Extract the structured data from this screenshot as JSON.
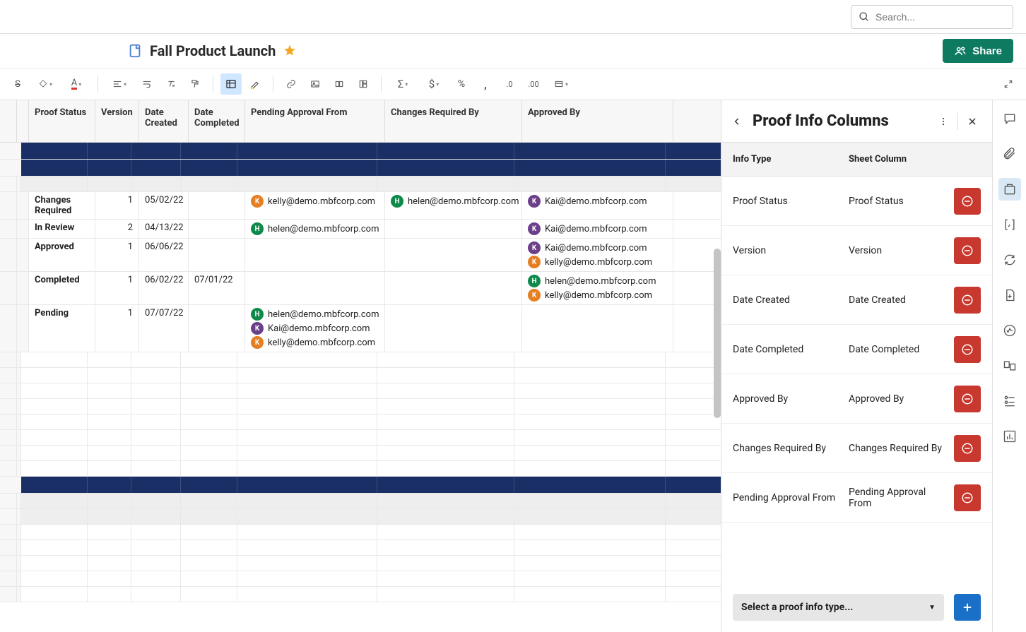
{
  "search": {
    "placeholder": "Search..."
  },
  "header": {
    "title": "Fall Product Launch",
    "share": "Share"
  },
  "grid": {
    "columns": {
      "proof_status": "Proof Status",
      "version": "Version",
      "date_created": "Date Created",
      "date_completed": "Date Completed",
      "pending_approval_from": "Pending Approval From",
      "changes_required_by": "Changes Required By",
      "approved_by": "Approved By"
    },
    "rows": [
      {
        "status": "Changes Required",
        "version": "1",
        "created": "05/02/22",
        "completed": "",
        "pending": [
          {
            "initial": "K",
            "cls": "av-k",
            "email": "kelly@demo.mbfcorp.com"
          }
        ],
        "changes": [
          {
            "initial": "H",
            "cls": "av-h",
            "email": "helen@demo.mbfcorp.com"
          }
        ],
        "approved": [
          {
            "initial": "K",
            "cls": "av-kai",
            "email": "Kai@demo.mbfcorp.com"
          }
        ]
      },
      {
        "status": "In Review",
        "version": "2",
        "created": "04/13/22",
        "completed": "",
        "pending": [
          {
            "initial": "H",
            "cls": "av-h",
            "email": "helen@demo.mbfcorp.com"
          }
        ],
        "changes": [],
        "approved": [
          {
            "initial": "K",
            "cls": "av-kai",
            "email": "Kai@demo.mbfcorp.com"
          }
        ]
      },
      {
        "status": "Approved",
        "version": "1",
        "created": "06/06/22",
        "completed": "",
        "pending": [],
        "changes": [],
        "approved": [
          {
            "initial": "K",
            "cls": "av-kai",
            "email": "Kai@demo.mbfcorp.com"
          },
          {
            "initial": "K",
            "cls": "av-k",
            "email": "kelly@demo.mbfcorp.com"
          }
        ]
      },
      {
        "status": "Completed",
        "version": "1",
        "created": "06/02/22",
        "completed": "07/01/22",
        "pending": [],
        "changes": [],
        "approved": [
          {
            "initial": "H",
            "cls": "av-h",
            "email": "helen@demo.mbfcorp.com"
          },
          {
            "initial": "K",
            "cls": "av-k",
            "email": "kelly@demo.mbfcorp.com"
          }
        ]
      },
      {
        "status": "Pending",
        "version": "1",
        "created": "07/07/22",
        "completed": "",
        "pending": [
          {
            "initial": "H",
            "cls": "av-h",
            "email": "helen@demo.mbfcorp.com"
          },
          {
            "initial": "K",
            "cls": "av-kai",
            "email": "Kai@demo.mbfcorp.com"
          },
          {
            "initial": "K",
            "cls": "av-k",
            "email": "kelly@demo.mbfcorp.com"
          }
        ],
        "changes": [],
        "approved": []
      }
    ]
  },
  "panel": {
    "title": "Proof Info Columns",
    "th_info": "Info Type",
    "th_sheet": "Sheet Column",
    "rows": [
      {
        "info": "Proof Status",
        "sheet": "Proof Status"
      },
      {
        "info": "Version",
        "sheet": "Version"
      },
      {
        "info": "Date Created",
        "sheet": "Date Created"
      },
      {
        "info": "Date Completed",
        "sheet": "Date Completed"
      },
      {
        "info": "Approved By",
        "sheet": "Approved By"
      },
      {
        "info": "Changes Required By",
        "sheet": "Changes Required By"
      },
      {
        "info": "Pending Approval From",
        "sheet": "Pending Approval From"
      }
    ],
    "select_placeholder": "Select a proof info type..."
  }
}
